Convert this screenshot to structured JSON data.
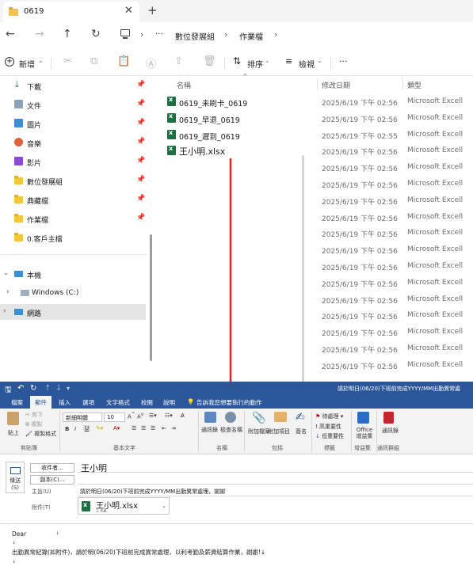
{
  "explorer": {
    "tab_title": "0619",
    "tab_close": "✕",
    "new_tab": "+",
    "nav": {
      "back": "←",
      "forward": "→",
      "up": "↑",
      "refresh": "↻",
      "more": "···"
    },
    "breadcrumb": [
      "數位發展組",
      "作業檔"
    ],
    "commands": {
      "new": "新增",
      "sort": "排序",
      "view": "檢視",
      "more": "···"
    },
    "sidebar": [
      {
        "label": "下載",
        "icon": "download-icon",
        "pinned": true
      },
      {
        "label": "文件",
        "icon": "document-icon",
        "pinned": true
      },
      {
        "label": "圖片",
        "icon": "picture-icon",
        "pinned": true
      },
      {
        "label": "音樂",
        "icon": "music-icon",
        "pinned": true
      },
      {
        "label": "影片",
        "icon": "video-icon",
        "pinned": true
      },
      {
        "label": "數位發展組",
        "icon": "folder-icon",
        "pinned": true
      },
      {
        "label": "典藏檔",
        "icon": "folder-icon",
        "pinned": true
      },
      {
        "label": "作業檔",
        "icon": "folder-icon",
        "pinned": true
      },
      {
        "label": "0.客戶主檔",
        "icon": "folder-icon",
        "pinned": false
      }
    ],
    "tree": {
      "this_pc": "本機",
      "windows_c": "Windows (C:)",
      "network": "網路"
    },
    "columns": {
      "name": "名稱",
      "date": "修改日期",
      "type": "類型"
    },
    "files": [
      {
        "name": "0619_未刷卡_0619",
        "date": "2025/6/19 下午 02:56",
        "type": "Microsoft Excell"
      },
      {
        "name": "0619_早退_0619",
        "date": "2025/6/19 下午 02:56",
        "type": "Microsoft Excell"
      },
      {
        "name": "0619_遲到_0619",
        "date": "2025/6/19 下午 02:55",
        "type": "Microsoft Excell"
      },
      {
        "name": "王小明.xlsx",
        "date": "2025/6/19 下午 02:56",
        "type": "Microsoft Excell"
      },
      {
        "name": "",
        "date": "2025/6/19 下午 02:56",
        "type": "Microsoft Excell"
      },
      {
        "name": "",
        "date": "2025/6/19 下午 02:56",
        "type": "Microsoft Excell"
      },
      {
        "name": "",
        "date": "2025/6/19 下午 02:56",
        "type": "Microsoft Excell"
      },
      {
        "name": "",
        "date": "2025/6/19 下午 02:56",
        "type": "Microsoft Excell"
      },
      {
        "name": "",
        "date": "2025/6/19 下午 02:56",
        "type": "Microsoft Excell"
      },
      {
        "name": "",
        "date": "2025/6/19 下午 02:56",
        "type": "Microsoft Excell"
      },
      {
        "name": "",
        "date": "2025/6/19 下午 02:56",
        "type": "Microsoft Excell"
      },
      {
        "name": "",
        "date": "2025/6/19 下午 02:56",
        "type": "Microsoft Excell"
      },
      {
        "name": "",
        "date": "2025/6/19 下午 02:56",
        "type": "Microsoft Excell"
      },
      {
        "name": "",
        "date": "2025/6/19 下午 02:56",
        "type": "Microsoft Excell"
      },
      {
        "name": "",
        "date": "2025/6/19 下午 02:56",
        "type": "Microsoft Excell"
      },
      {
        "name": "",
        "date": "2025/6/19 下午 02:56",
        "type": "Microsoft Excell"
      },
      {
        "name": "",
        "date": "2025/6/19 下午 02:56",
        "type": "Microsoft Excell"
      }
    ]
  },
  "outlook": {
    "window_title": "請於明日(06/20)下班前完成YYYY/MM出勤異常處",
    "tell_me": "告訴我您想要執行的動作",
    "tabs": [
      "檔案",
      "郵件",
      "插入",
      "選項",
      "文字格式",
      "校閱",
      "說明"
    ],
    "ribbon": {
      "paste": "貼上",
      "cut": "剪下",
      "copy": "複製",
      "format_painter": "複製格式",
      "clipboard": "剪貼簿",
      "font_name": "新細明體",
      "font_size": "10",
      "basic_text": "基本文字",
      "address_book": "通訊錄",
      "check_names": "檢查名稱",
      "names": "名稱",
      "attach_file": "附加檔案",
      "attach_item": "附加項目",
      "signature": "簽名",
      "include": "包括",
      "follow_up": "待處理",
      "high_importance": "高重要性",
      "low_importance": "低重要性",
      "tags": "標籤",
      "office_addins": "Office 增益集",
      "addins": "增益集",
      "contacts": "通訊錄",
      "contact_group": "通訊群組"
    },
    "compose": {
      "send": "傳送(S)",
      "to_button": "收件者...",
      "cc_button": "副本(C)...",
      "to_value": "王小明",
      "subject_label": "主旨(U)",
      "subject_value": "請於明日(06/20)下班前完成YYYY/MM出勤異常處理，謝謝",
      "attached_label": "附件(T)",
      "attachment_name": "王小明.xlsx",
      "attachment_size": "1 KB",
      "body_line1": "Dear",
      "body_line1_mark": "↓",
      "body_line2": "↓",
      "body_line3": "出勤異常紀錄(如附件)，請於明(06/20)下班前完成異常處理，以利考勤及薪資結算作業，謝謝!↓",
      "body_line4": "↓"
    }
  },
  "colors": {
    "outlook_blue": "#2b579a",
    "excel_green": "#1d6f42",
    "arrow_red": "#e02020",
    "folder_yellow": "#f4c543"
  }
}
